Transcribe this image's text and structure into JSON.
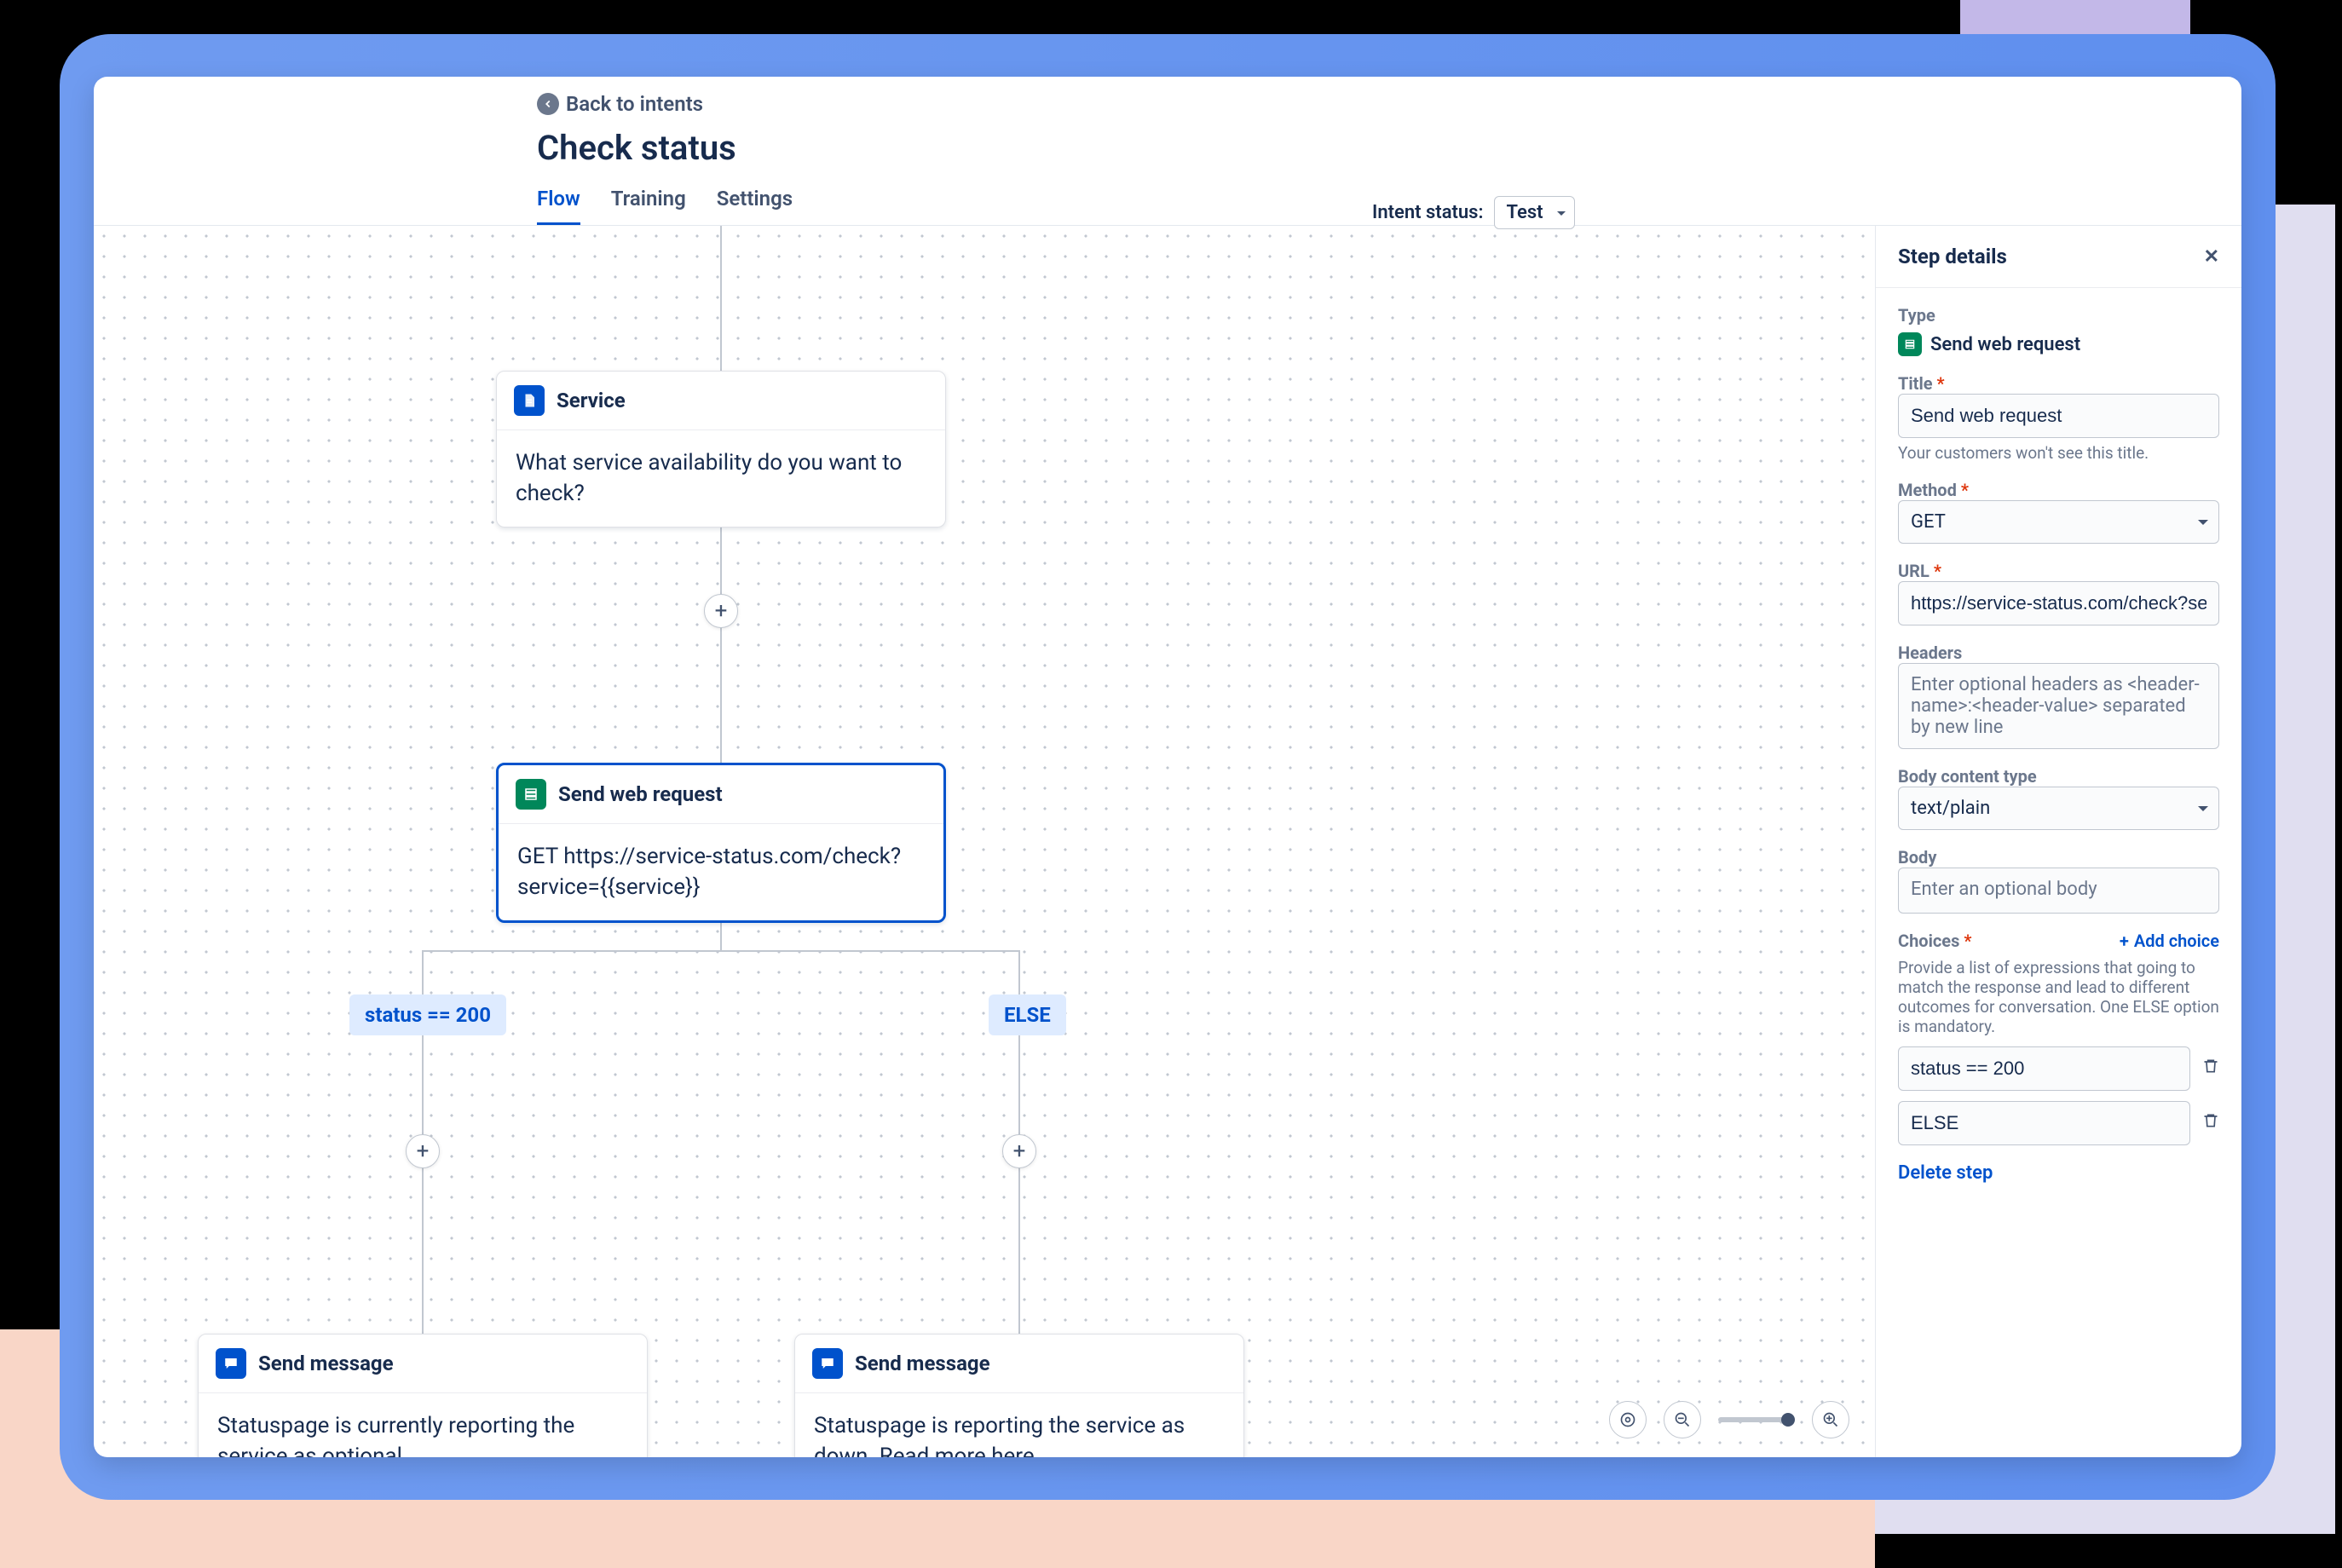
{
  "back_label": "Back to intents",
  "title": "Check status",
  "intent_status_label": "Intent status:",
  "intent_status_value": "Test",
  "tabs": {
    "flow": "Flow",
    "training": "Training",
    "settings": "Settings"
  },
  "nodes": {
    "service": {
      "title": "Service",
      "body": "What service availability do you want to check?"
    },
    "web": {
      "title": "Send web request",
      "body": "GET https://service-status.com/check?service={{service}}"
    },
    "msg_left": {
      "title": "Send message",
      "body": "Statuspage is currently reporting the service as optional."
    },
    "msg_right": {
      "title": "Send message",
      "body": "Statuspage is reporting the service as down. Read more here."
    }
  },
  "branches": {
    "left": "status == 200",
    "right": "ELSE"
  },
  "panel": {
    "header": "Step details",
    "type_label": "Type",
    "type_value": "Send web request",
    "title_label": "Title",
    "title_value": "Send web request",
    "title_hint": "Your customers won't see this title.",
    "method_label": "Method",
    "method_value": "GET",
    "url_label": "URL",
    "url_value": "https://service-status.com/check?service={{service}}",
    "headers_label": "Headers",
    "headers_placeholder": "Enter optional headers as <header-name>:<header-value> separated by new line",
    "bodytype_label": "Body content type",
    "bodytype_value": "text/plain",
    "body_label": "Body",
    "body_placeholder": "Enter an optional body",
    "choices_label": "Choices",
    "add_choice": "Add choice",
    "choices_desc": "Provide a list of expressions that going to match the response and lead to different outcomes for conversation. One ELSE option is mandatory.",
    "choice1": "status == 200",
    "choice2": "ELSE",
    "delete_step": "Delete step"
  }
}
